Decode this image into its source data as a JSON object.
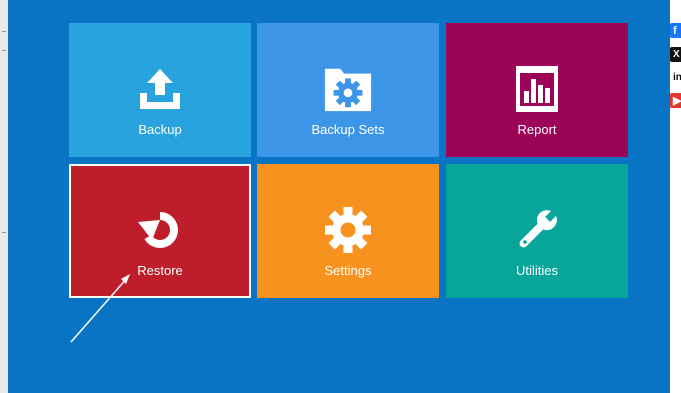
{
  "tiles": {
    "backup": {
      "label": "Backup",
      "icon": "upload-icon",
      "color": "#29a3dd"
    },
    "backup_sets": {
      "label": "Backup Sets",
      "icon": "folder-gear-icon",
      "color": "#3d95e8"
    },
    "report": {
      "label": "Report",
      "icon": "bar-chart-icon",
      "color": "#9b0457"
    },
    "restore": {
      "label": "Restore",
      "icon": "restore-icon",
      "color": "#be1d2c",
      "selected": true
    },
    "settings": {
      "label": "Settings",
      "icon": "gear-icon",
      "color": "#f7921f"
    },
    "utilities": {
      "label": "Utilities",
      "icon": "wrench-icon",
      "color": "#08a69a"
    }
  },
  "social": {
    "facebook": {
      "glyph": "f",
      "icon": "facebook-icon"
    },
    "x": {
      "glyph": "X",
      "icon": "x-icon"
    },
    "linkedin": {
      "glyph": "in",
      "icon": "linkedin-icon"
    },
    "youtube": {
      "glyph": "▶",
      "icon": "youtube-icon"
    }
  },
  "colors": {
    "background": "#0a74c4",
    "text": "#ffffff"
  }
}
